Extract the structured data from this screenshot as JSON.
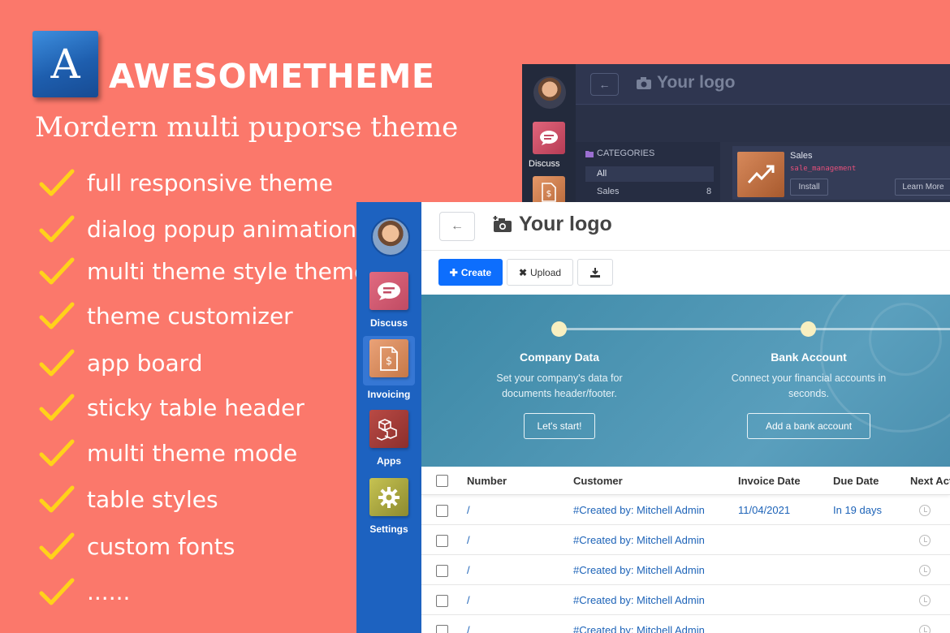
{
  "promo": {
    "logo_letter": "A",
    "brand": "AWESOMETHEME",
    "tagline": "Mordern multi puporse theme",
    "features": [
      "full responsive theme",
      "dialog popup animation",
      "multi theme style theme",
      "theme customizer",
      "app board",
      "sticky table header",
      "multi theme mode",
      "table styles",
      "custom fonts",
      "......"
    ],
    "check_color": "#ffd21a"
  },
  "dark_app": {
    "logo_text": "Your logo",
    "discuss_label": "Discuss",
    "categories_title": "CATEGORIES",
    "category_all": "All",
    "category_sales": "Sales",
    "category_sales_count": "8",
    "card": {
      "title": "Sales",
      "technical_name": "sale_management",
      "install_label": "Install",
      "learn_more_label": "Learn More"
    }
  },
  "light_app": {
    "logo_text": "Your logo",
    "sidebar": [
      {
        "label": "Discuss",
        "icon": "chat-bubble-icon"
      },
      {
        "label": "Invoicing",
        "icon": "invoice-icon"
      },
      {
        "label": "Apps",
        "icon": "cubes-icon"
      },
      {
        "label": "Settings",
        "icon": "gear-icon"
      }
    ],
    "toolbar": {
      "create_label": "Create",
      "upload_label": "Upload"
    },
    "onboarding": {
      "steps": [
        {
          "title": "Company Data",
          "desc": "Set your company's data for documents header/footer.",
          "button": "Let's start!"
        },
        {
          "title": "Bank Account",
          "desc": "Connect your financial accounts in seconds.",
          "button": "Add a bank account"
        }
      ]
    },
    "table": {
      "columns": [
        "Number",
        "Customer",
        "Invoice Date",
        "Due Date",
        "Next Act"
      ],
      "rows": [
        {
          "number": "/",
          "customer": "#Created by: Mitchell Admin",
          "invoice_date": "11/04/2021",
          "due_date": "In 19 days"
        },
        {
          "number": "/",
          "customer": "#Created by: Mitchell Admin",
          "invoice_date": "",
          "due_date": ""
        },
        {
          "number": "/",
          "customer": "#Created by: Mitchell Admin",
          "invoice_date": "",
          "due_date": ""
        },
        {
          "number": "/",
          "customer": "#Created by: Mitchell Admin",
          "invoice_date": "",
          "due_date": ""
        },
        {
          "number": "/",
          "customer": "#Created by: Mitchell Admin",
          "invoice_date": "",
          "due_date": ""
        }
      ]
    }
  },
  "colors": {
    "background": "#fb786b",
    "light_sidebar": "#1d62c0",
    "primary_button": "#0d6efd",
    "dark_bg": "#2c3349"
  }
}
